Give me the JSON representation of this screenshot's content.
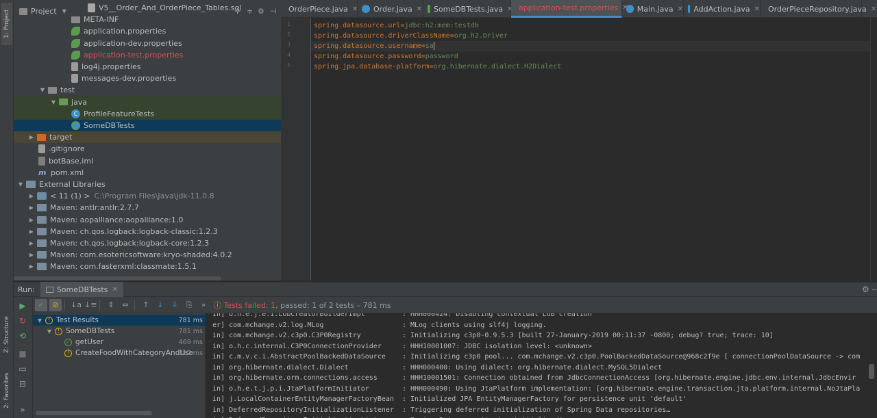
{
  "sidebar": {
    "project_tab": "1: Project",
    "structure_tab": "Z: Structure",
    "favorites_tab": "2: Favorites"
  },
  "project": {
    "header_title": "Project",
    "tree": [
      {
        "label": "V5__Order_And_OrderPiece_Tables.sql",
        "icon": "sql-file-icon",
        "indent": 108
      },
      {
        "label": "META-INF",
        "icon": "folder-icon",
        "indent": 84
      },
      {
        "label": "application.properties",
        "icon": "spring-properties-icon",
        "indent": 84
      },
      {
        "label": "application-dev.properties",
        "icon": "spring-properties-icon",
        "indent": 84
      },
      {
        "label": "application-test.properties",
        "icon": "spring-properties-icon",
        "indent": 84,
        "red": true
      },
      {
        "label": "log4j.properties",
        "icon": "properties-file-icon",
        "indent": 84
      },
      {
        "label": "messages-dev.properties",
        "icon": "properties-file-icon",
        "indent": 84
      },
      {
        "label": "test",
        "icon": "folder-icon",
        "indent": 36,
        "arrow": "down"
      },
      {
        "label": "java",
        "icon": "test-folder-icon",
        "indent": 52,
        "arrow": "down"
      },
      {
        "label": "ProfileFeatureTests",
        "icon": "java-class-icon",
        "indent": 84
      },
      {
        "label": "SomeDBTests",
        "icon": "test-class-icon",
        "indent": 84
      },
      {
        "label": "target",
        "icon": "excluded-folder-icon",
        "indent": 20,
        "arrow": "right"
      },
      {
        "label": ".gitignore",
        "icon": "file-icon",
        "indent": 36
      },
      {
        "label": "botBase.iml",
        "icon": "iml-file-icon",
        "indent": 36
      },
      {
        "label": "pom.xml",
        "icon": "maven-icon",
        "indent": 36
      },
      {
        "label": "External Libraries",
        "icon": "library-icon",
        "indent": 4,
        "arrow": "down"
      },
      {
        "label": "< 11 (1) >",
        "extra": "C:\\Program Files\\Java\\jdk-11.0.8",
        "icon": "jdk-icon",
        "indent": 20,
        "arrow": "right"
      },
      {
        "label": "Maven: antlr:antlr:2.7.7",
        "icon": "library-icon",
        "indent": 20,
        "arrow": "right"
      },
      {
        "label": "Maven: aopalliance:aopalliance:1.0",
        "icon": "library-icon",
        "indent": 20,
        "arrow": "right"
      },
      {
        "label": "Maven: ch.qos.logback:logback-classic:1.2.3",
        "icon": "library-icon",
        "indent": 20,
        "arrow": "right"
      },
      {
        "label": "Maven: ch.qos.logback:logback-core:1.2.3",
        "icon": "library-icon",
        "indent": 20,
        "arrow": "right"
      },
      {
        "label": "Maven: com.esotericsoftware:kryo-shaded:4.0.2",
        "icon": "library-icon",
        "indent": 20,
        "arrow": "right"
      },
      {
        "label": "Maven: com.fasterxml:classmate:1.5.1",
        "icon": "library-icon",
        "indent": 20,
        "arrow": "right"
      }
    ]
  },
  "editor": {
    "tabs": [
      {
        "label": "OrderPiece.java",
        "icon": "c"
      },
      {
        "label": "Order.java",
        "icon": "c"
      },
      {
        "label": "SomeDBTests.java",
        "icon": "t"
      },
      {
        "label": "application-test.properties",
        "icon": "leaf",
        "active": true
      },
      {
        "label": "Main.java",
        "icon": "c"
      },
      {
        "label": "AddAction.java",
        "icon": "c"
      },
      {
        "label": "OrderPieceRepository.java",
        "icon": "i"
      }
    ],
    "lines": [
      {
        "num": "1",
        "key": "spring.datasource.url",
        "value": "jdbc:h2:mem:testdb"
      },
      {
        "num": "2",
        "key": "spring.datasource.driverClassName",
        "value": "org.h2.Driver"
      },
      {
        "num": "3",
        "key": "spring.datasource.username",
        "value": "sa",
        "current": true
      },
      {
        "num": "4",
        "key": "spring.datasource.password",
        "value": "password"
      },
      {
        "num": "5",
        "key": "spring.jpa.database-platform",
        "value": "org.hibernate.dialect.H2Dialect"
      }
    ]
  },
  "run": {
    "label": "Run:",
    "tab_label": "SomeDBTests",
    "status_failed": "Tests failed: 1",
    "status_rest": ", passed: 1 of 2 tests – 781 ms",
    "results": [
      {
        "label": "Test Results",
        "time": "781 ms",
        "status": "warn",
        "indent": 4,
        "selected": true
      },
      {
        "label": "SomeDBTests",
        "time": "781 ms",
        "status": "warn",
        "indent": 18
      },
      {
        "label": "getUser",
        "time": "469 ms",
        "status": "ok",
        "indent": 46
      },
      {
        "label": "CreateFoodWithCategoryAndUse",
        "time": "312 ms",
        "status": "warn",
        "indent": 46
      }
    ],
    "console": [
      "in] o.h.e.j.e.i.LobCreatorBuilderImpl         : HHH000424: Disabling contextual LOB creation",
      "er] com.mchange.v2.log.MLog                   : MLog clients using slf4j logging.",
      "in] com.mchange.v2.c3p0.C3P0Registry          : Initializing c3p0-0.9.5.3 [built 27-January-2019 00:11:37 -0800; debug? true; trace: 10]",
      "in] o.h.c.internal.C3P0ConnectionProvider     : HHH10001007: JDBC isolation level: <unknown>",
      "in] c.m.v.c.i.AbstractPoolBackedDataSource    : Initializing c3p0 pool... com.mchange.v2.c3p0.PoolBackedDataSource@968c2f9e [ connectionPoolDataSource -> com",
      "in] org.hibernate.dialect.Dialect             : HHH000400: Using dialect: org.hibernate.dialect.MySQL5Dialect",
      "in] org.hibernate.orm.connections.access      : HHH10001501: Connection obtained from JdbcConnectionAccess [org.hibernate.engine.jdbc.env.internal.JdbcEnvir",
      "in] o.h.e.t.j.p.i.JtaPlatformInitiator        : HHH000490: Using JtaPlatform implementation: [org.hibernate.engine.transaction.jta.platform.internal.NoJtaPla",
      "in] j.LocalContainerEntityManagerFactoryBean  : Initialized JPA EntityManagerFactory for persistence unit 'default'",
      "in] DeferredRepositoryInitializationListener  : Triggering deferred initialization of Spring Data repositories…",
      "in] DeferredRepositoryInitializationListener  : Spring Data repositories initialized!"
    ]
  }
}
